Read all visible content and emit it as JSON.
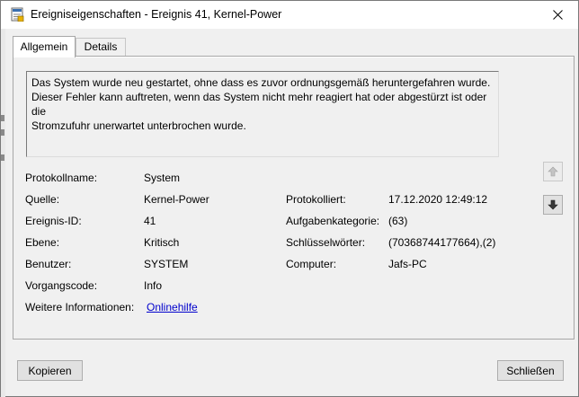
{
  "window": {
    "title": "Ereigniseigenschaften - Ereignis 41, Kernel-Power"
  },
  "tabs": [
    {
      "label": "Allgemein",
      "active": true
    },
    {
      "label": "Details",
      "active": false
    }
  ],
  "description": "Das System wurde neu gestartet, ohne dass es zuvor ordnungsgemäß heruntergefahren wurde.\nDieser Fehler kann auftreten, wenn das System nicht mehr reagiert hat oder abgestürzt ist oder die\nStromzufuhr unerwartet unterbrochen wurde.",
  "fields": {
    "log_name": {
      "label": "Protokollname:",
      "value": "System"
    },
    "source": {
      "label": "Quelle:",
      "value": "Kernel-Power"
    },
    "event_id": {
      "label": "Ereignis-ID:",
      "value": "41"
    },
    "level": {
      "label": "Ebene:",
      "value": "Kritisch"
    },
    "user": {
      "label": "Benutzer:",
      "value": "SYSTEM"
    },
    "opcode": {
      "label": "Vorgangscode:",
      "value": "Info"
    },
    "more_info": {
      "label": "Weitere Informationen:",
      "value": "Onlinehilfe"
    },
    "logged": {
      "label": "Protokolliert:",
      "value": "17.12.2020 12:49:12"
    },
    "task_category": {
      "label": "Aufgabenkategorie:",
      "value": "(63)"
    },
    "keywords": {
      "label": "Schlüsselwörter:",
      "value": "(70368744177664),(2)"
    },
    "computer": {
      "label": "Computer:",
      "value": "Jafs-PC"
    }
  },
  "buttons": {
    "copy": "Kopieren",
    "close": "Schließen"
  },
  "icons": {
    "title": "event-log-icon",
    "close": "close-icon",
    "up": "arrow-up-icon",
    "down": "arrow-down-icon"
  }
}
